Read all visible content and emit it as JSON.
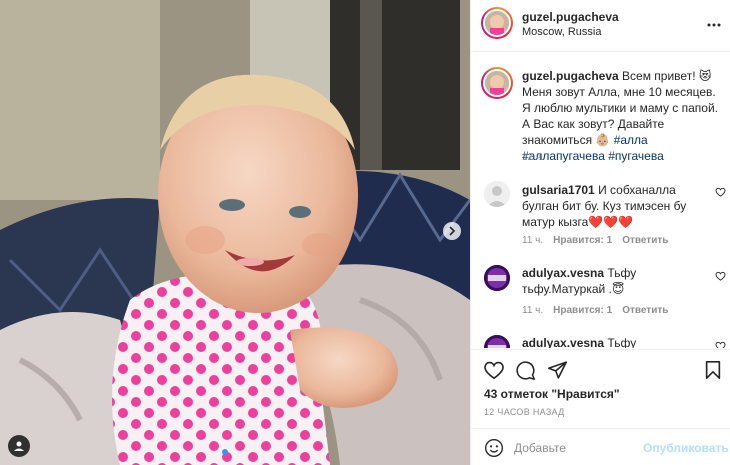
{
  "post": {
    "author": "guzel.pugacheva",
    "location": "Moscow, Russia",
    "caption": {
      "text": "Всем привет! 😻 Меня зовут Алла, мне 10 месяцев. Я люблю мультики и маму с папой. А Вас как зовут? Давайте знакомиться 👶🏼",
      "hashtags": [
        "#алла",
        "#аллапугачева",
        "#пугачева"
      ],
      "time": "12 ч."
    },
    "carousel": {
      "slides": 2,
      "active": 1
    }
  },
  "comments": [
    {
      "user": "gulsaria1701",
      "text": "И собханалла булган бит бу. Куз тимэсен бу матур кызга❤️❤️❤️",
      "time": "11 ч.",
      "likes": "Нравится: 1",
      "reply": "Ответить"
    },
    {
      "user": "adulyax.vesna",
      "text": "Тьфу тьфу.Матуркай .😇",
      "time": "11 ч.",
      "likes": "Нравится: 1",
      "reply": "Ответить"
    },
    {
      "user": "adulyax.vesna",
      "text": "Тьфу"
    }
  ],
  "engagement": {
    "likes": "43 отметок \"Нравится\"",
    "ago": "12 ЧАСОВ НАЗАД"
  },
  "add_comment": {
    "placeholder": "Добавьте",
    "publish": "Опубликовать"
  },
  "icons": {
    "more": "more-horizontal-icon",
    "like": "heart-outline-icon",
    "comment": "comment-icon",
    "share": "paper-plane-icon",
    "save": "bookmark-icon",
    "emoji": "smiley-icon",
    "tag": "person-tag-icon",
    "next": "chevron-right-icon"
  },
  "colors": {
    "accent": "#3897f0",
    "hashtag": "#00376b",
    "muted": "#8e8e8e",
    "publish": "#b2dffc"
  }
}
